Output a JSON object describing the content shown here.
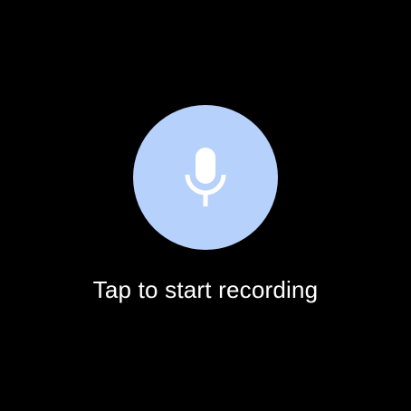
{
  "record": {
    "icon": "microphone-icon",
    "button_color": "#b6d1fb",
    "icon_color": "#ffffff"
  },
  "prompt": {
    "label": "Tap to start recording"
  },
  "background_color": "#000000"
}
